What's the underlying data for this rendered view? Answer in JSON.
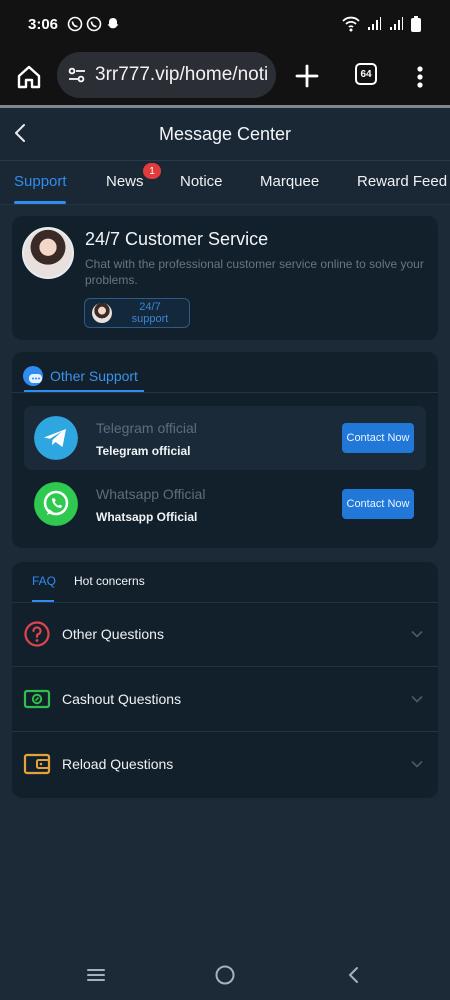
{
  "status_bar": {
    "time": "3:06"
  },
  "browser": {
    "url": "3rr777.vip/home/noti",
    "tab_count": "64"
  },
  "header": {
    "title": "Message Center"
  },
  "tabs": [
    {
      "label": "Support"
    },
    {
      "label": "News",
      "badge": "1"
    },
    {
      "label": "Notice"
    },
    {
      "label": "Marquee"
    },
    {
      "label": "Reward Feed"
    }
  ],
  "customer_service": {
    "title": "24/7 Customer Service",
    "description": "Chat with the professional customer service online to solve your problems.",
    "chip_label": "24/7 support"
  },
  "other_support": {
    "label": "Other Support",
    "contacts": [
      {
        "title": "Telegram official",
        "subtitle": "Telegram official",
        "button": "Contact Now",
        "icon": "telegram-icon"
      },
      {
        "title": "Whatsapp Official",
        "subtitle": "Whatsapp Official",
        "button": "Contact Now",
        "icon": "whatsapp-icon"
      }
    ]
  },
  "faq": {
    "tabs": [
      "FAQ",
      "Hot concerns"
    ],
    "items": [
      {
        "label": "Other Questions",
        "icon": "question-icon"
      },
      {
        "label": "Cashout Questions",
        "icon": "cash-icon"
      },
      {
        "label": "Reload Questions",
        "icon": "wallet-icon"
      }
    ]
  },
  "colors": {
    "accent": "#2f8df0",
    "background": "#1c2a38",
    "card": "#12202c",
    "button": "#2178d9",
    "badge": "#e23b3b"
  }
}
